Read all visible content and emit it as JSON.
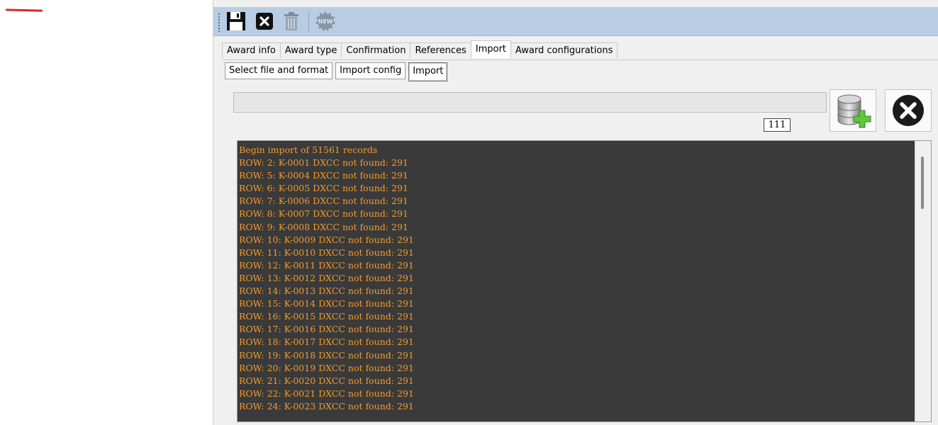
{
  "toolbar": {
    "icons": [
      "save-icon",
      "close-icon",
      "delete-icon",
      "new-icon"
    ],
    "new_label": "NEW"
  },
  "tabs": [
    {
      "label": "Award info",
      "active": false
    },
    {
      "label": "Award type",
      "active": false
    },
    {
      "label": "Confirmation",
      "active": false
    },
    {
      "label": "References",
      "active": false
    },
    {
      "label": "Import",
      "active": true
    },
    {
      "label": "Award configurations",
      "active": false
    }
  ],
  "subtabs": [
    {
      "label": "Select file and format",
      "active": false
    },
    {
      "label": "Import config",
      "active": false
    },
    {
      "label": "Import",
      "active": true
    }
  ],
  "progress": {
    "value": 0,
    "counter": "111",
    "fill_color": "#06b025"
  },
  "actions": {
    "import_icon": "database-add-icon",
    "cancel_icon": "cancel-icon"
  },
  "log": {
    "text_color": "#f29b2c",
    "background": "#3a3a3a",
    "lines": [
      "Begin import of 51561 records",
      "ROW: 2: K-0001 DXCC not found: 291",
      "ROW: 5: K-0004 DXCC not found: 291",
      "ROW: 6: K-0005 DXCC not found: 291",
      "ROW: 7: K-0006 DXCC not found: 291",
      "ROW: 8: K-0007 DXCC not found: 291",
      "ROW: 9: K-0008 DXCC not found: 291",
      "ROW: 10: K-0009 DXCC not found: 291",
      "ROW: 11: K-0010 DXCC not found: 291",
      "ROW: 12: K-0011 DXCC not found: 291",
      "ROW: 13: K-0012 DXCC not found: 291",
      "ROW: 14: K-0013 DXCC not found: 291",
      "ROW: 15: K-0014 DXCC not found: 291",
      "ROW: 16: K-0015 DXCC not found: 291",
      "ROW: 17: K-0016 DXCC not found: 291",
      "ROW: 18: K-0017 DXCC not found: 291",
      "ROW: 19: K-0018 DXCC not found: 291",
      "ROW: 20: K-0019 DXCC not found: 291",
      "ROW: 21: K-0020 DXCC not found: 291",
      "ROW: 22: K-0021 DXCC not found: 291",
      "ROW: 24: K-0023 DXCC not found: 291"
    ]
  }
}
